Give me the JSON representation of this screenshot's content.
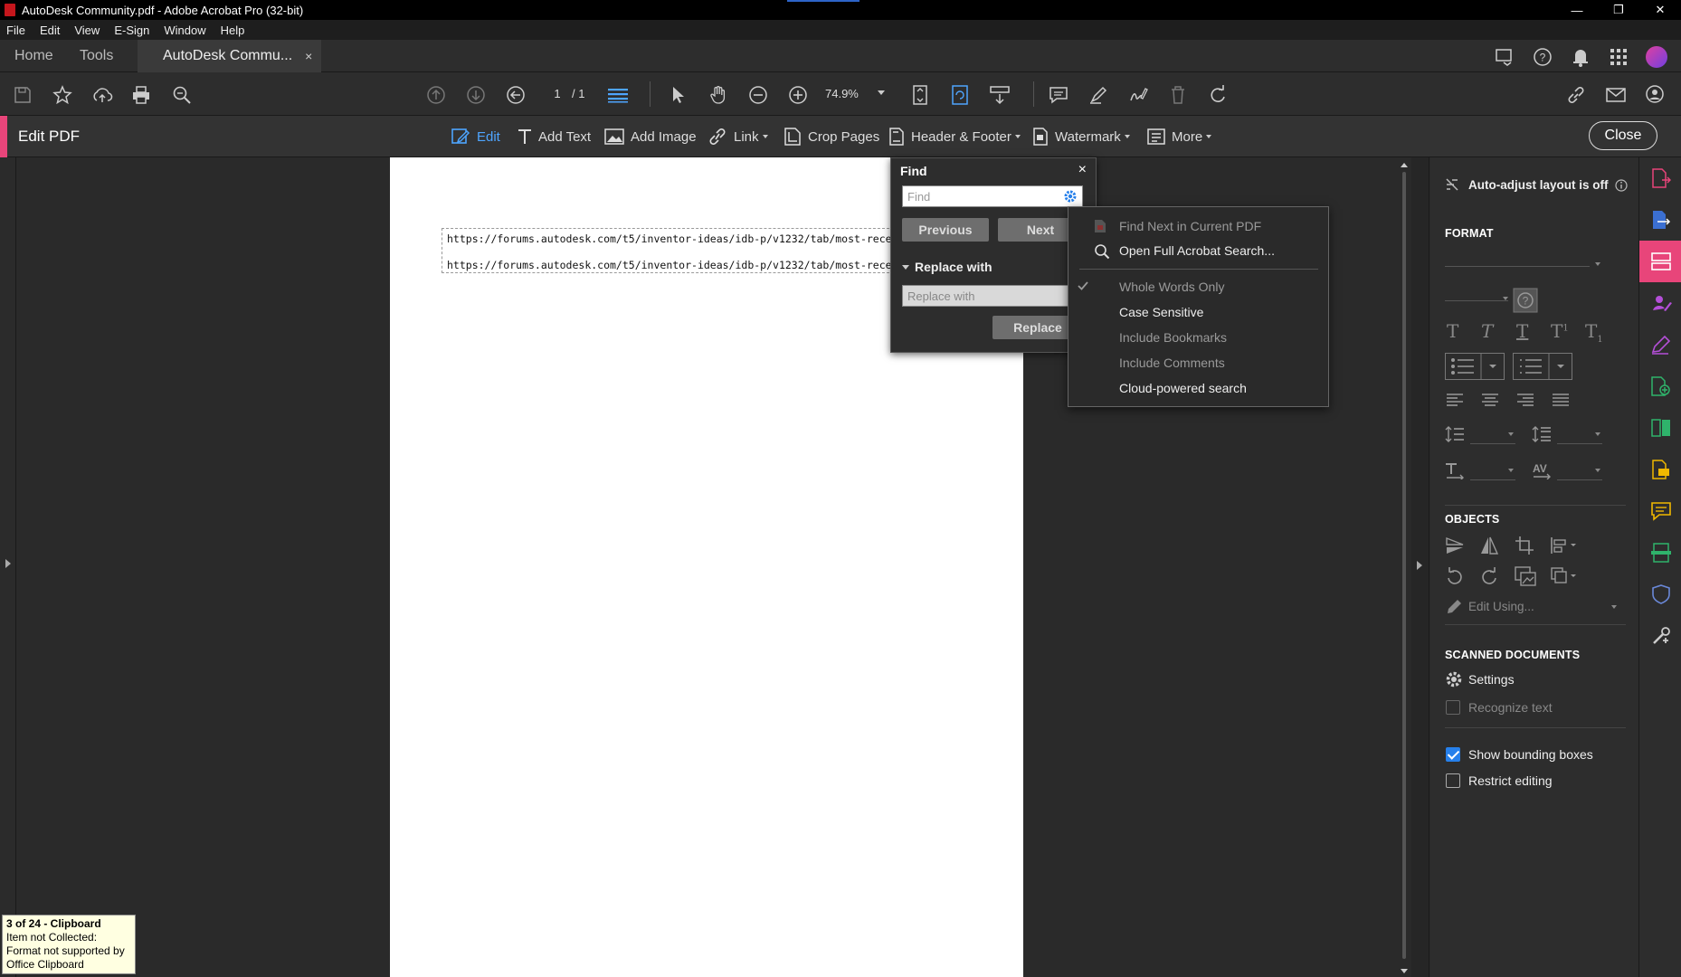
{
  "window": {
    "title": "AutoDesk Community.pdf - Adobe Acrobat Pro (32-bit)"
  },
  "menu": [
    "File",
    "Edit",
    "View",
    "E-Sign",
    "Window",
    "Help"
  ],
  "tabs": {
    "home": "Home",
    "tools": "Tools",
    "doc": "AutoDesk Commu...",
    "close": "×"
  },
  "toolbar": {
    "page_current": "1",
    "page_total": "/ 1",
    "zoom": "74.9%"
  },
  "editbar": {
    "title": "Edit PDF",
    "edit": "Edit",
    "add_text": "Add Text",
    "add_image": "Add Image",
    "link": "Link",
    "crop_pages": "Crop Pages",
    "header_footer": "Header & Footer",
    "watermark": "Watermark",
    "more": "More",
    "close": "Close"
  },
  "document": {
    "lines": [
      "https://forums.autodesk.com/t5/inventor-ideas/idb-p/v1232/tab/most-rece",
      "https://forums.autodesk.com/t5/inventor-ideas/idb-p/v1232/tab/most-rece"
    ]
  },
  "find": {
    "title": "Find",
    "close": "×",
    "placeholder": "Find",
    "previous": "Previous",
    "next": "Next",
    "replace_header": "Replace with",
    "replace_placeholder": "Replace with",
    "replace_button": "Replace"
  },
  "find_menu": {
    "find_next": "Find Next in Current PDF",
    "open_full": "Open Full Acrobat Search...",
    "whole_words": "Whole Words Only",
    "case_sensitive": "Case Sensitive",
    "include_bookmarks": "Include Bookmarks",
    "include_comments": "Include Comments",
    "cloud_search": "Cloud-powered search"
  },
  "right_panel": {
    "auto_adjust": "Auto-adjust layout is off",
    "format": "FORMAT",
    "objects": "OBJECTS",
    "edit_using": "Edit Using...",
    "scanned": "SCANNED DOCUMENTS",
    "settings": "Settings",
    "recognize": "Recognize text",
    "show_bbox": "Show bounding boxes",
    "restrict": "Restrict editing",
    "show_bbox_checked": true,
    "restrict_checked": false
  },
  "clipboard_tip": {
    "title": "3 of 24 - Clipboard",
    "body": "Item not Collected: Format not supported by Office Clipboard"
  },
  "colors": {
    "accent_pink": "#e8457a",
    "accent_blue": "#4ea5ff",
    "checkbox_blue": "#2680eb"
  }
}
